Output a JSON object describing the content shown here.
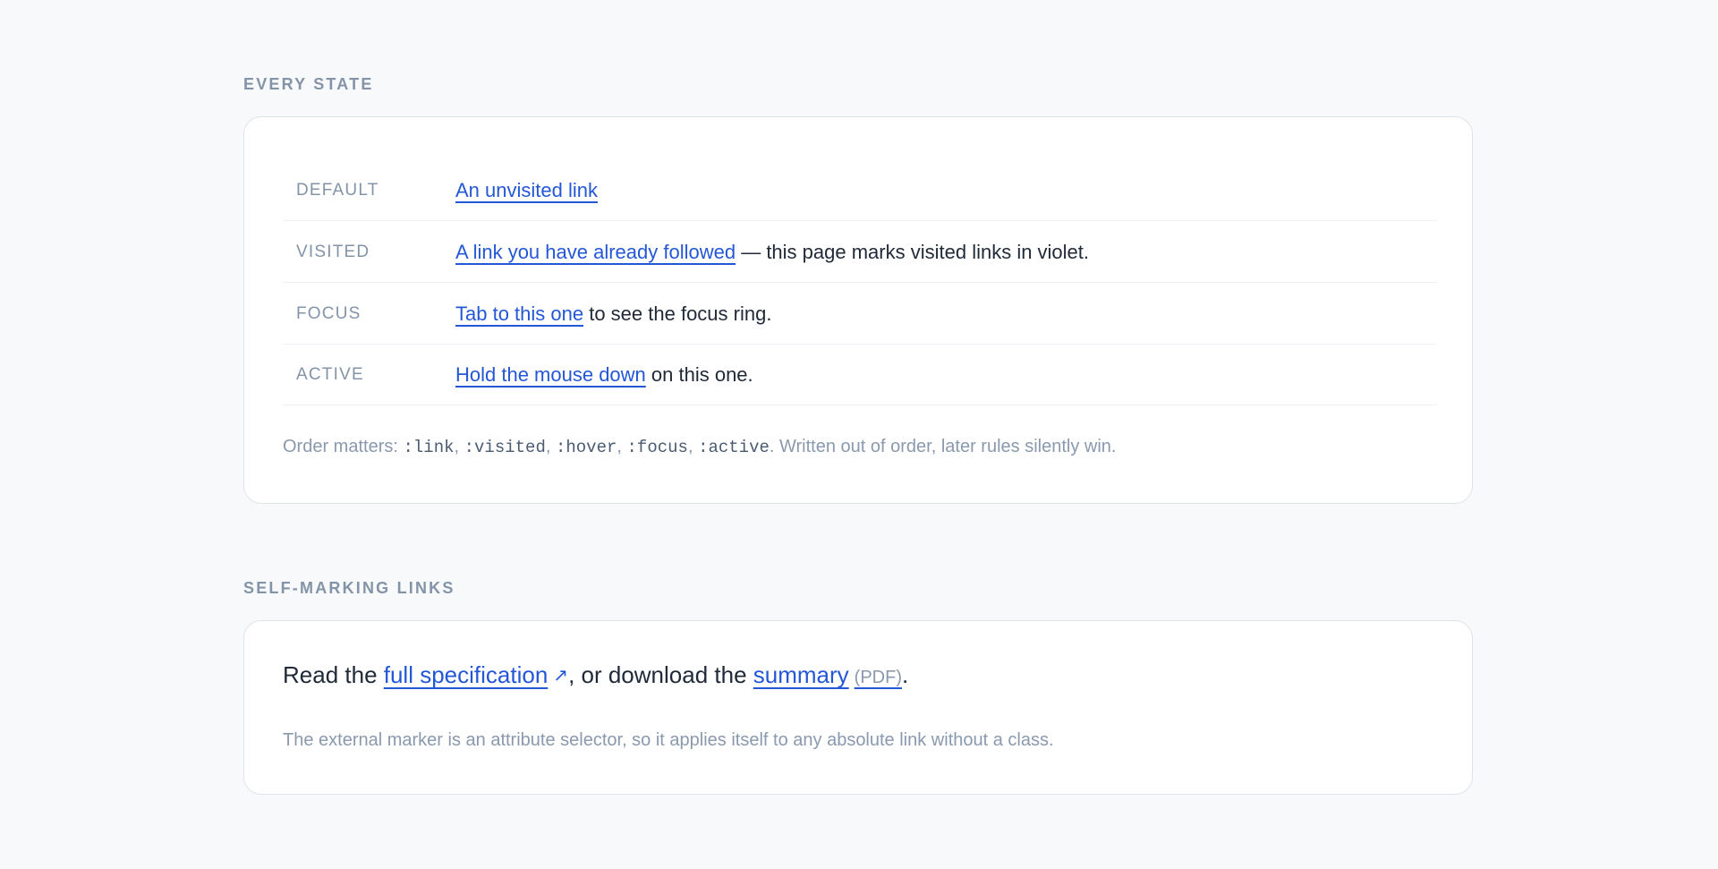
{
  "sections": {
    "states_label": "EVERY STATE",
    "marks_label": "SELF-MARKING LINKS"
  },
  "states": [
    {
      "name": "DEFAULT",
      "link": "An unvisited link",
      "rest": ""
    },
    {
      "name": "VISITED",
      "link": "A link you have already followed",
      "rest": " — this page marks visited links in violet."
    },
    {
      "name": "FOCUS",
      "link": "Tab to this one",
      "rest": " to see the focus ring."
    },
    {
      "name": "ACTIVE",
      "link": "Hold the mouse down",
      "rest": " on this one."
    }
  ],
  "order_note": {
    "prefix": "Order matters: ",
    "sel_link": ":link",
    "sel_visited": ":visited",
    "sel_hover": ":hover",
    "sel_focus": ":focus",
    "sel_active": ":active",
    "sep": ", ",
    "suffix": ". Written out of order, later rules silently win."
  },
  "marks": {
    "lead_prefix": "Read the ",
    "spec_link": "full specification",
    "ext_icon": "↗",
    "mid": ", or download the ",
    "summary_link": "summary",
    "pdf_tag": "(PDF)",
    "end": ".",
    "note": "The external marker is an attribute selector, so it applies itself to any absolute link without a class."
  },
  "colors": {
    "link": "#2457d6",
    "muted": "#8494a8",
    "background": "#f8f9fb"
  }
}
